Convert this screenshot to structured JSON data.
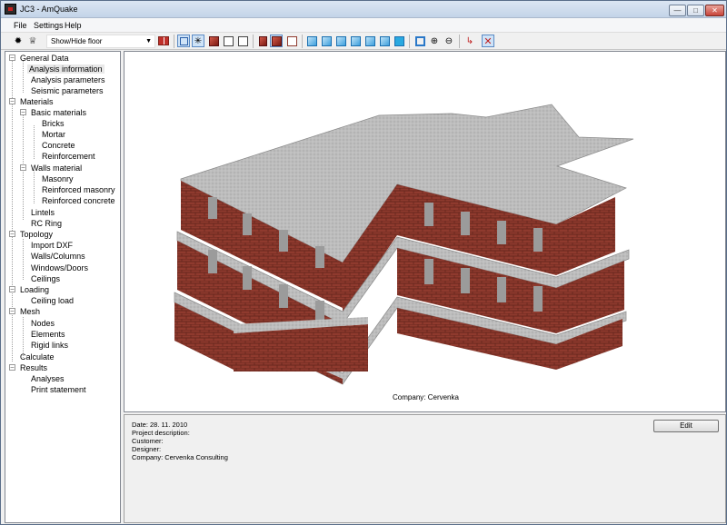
{
  "window": {
    "title": "JC3 - AmQuake"
  },
  "menu": [
    "File",
    "Settings",
    "Help"
  ],
  "toolbar": {
    "floor_select": "Show/Hide floor"
  },
  "tree": {
    "general_data": "General Data",
    "analysis_information": "Analysis information",
    "analysis_parameters": "Analysis parameters",
    "seismic_parameters": "Seismic parameters",
    "materials": "Materials",
    "basic_materials": "Basic materials",
    "bricks": "Bricks",
    "mortar": "Mortar",
    "concrete": "Concrete",
    "reinforcement": "Reinforcement",
    "walls_material": "Walls material",
    "masonry": "Masonry",
    "reinforced_masonry": "Reinforced masonry",
    "reinforced_concrete": "Reinforced concrete",
    "lintels": "Lintels",
    "rc_ring": "RC Ring",
    "topology": "Topology",
    "import_dxf": "Import DXF",
    "walls_columns": "Walls/Columns",
    "windows_doors": "Windows/Doors",
    "ceilings": "Ceilings",
    "loading": "Loading",
    "ceiling_load": "Ceiling load",
    "mesh": "Mesh",
    "nodes": "Nodes",
    "elements": "Elements",
    "rigid_links": "Rigid links",
    "calculate": "Calculate",
    "results": "Results",
    "analyses": "Analyses",
    "print_statement": "Print statement"
  },
  "viewport": {
    "company_caption": "Company: Cervenka"
  },
  "info": {
    "date": "Date: 28. 11. 2010",
    "project_description": "Project description:",
    "customer": "Customer:",
    "designer": "Designer:",
    "company": "Company: Cervenka Consulting"
  },
  "buttons": {
    "edit": "Edit"
  },
  "colors": {
    "brick": "#8f3a2e",
    "slab": "#bdbdbd",
    "selection": "#e8e8e8"
  }
}
